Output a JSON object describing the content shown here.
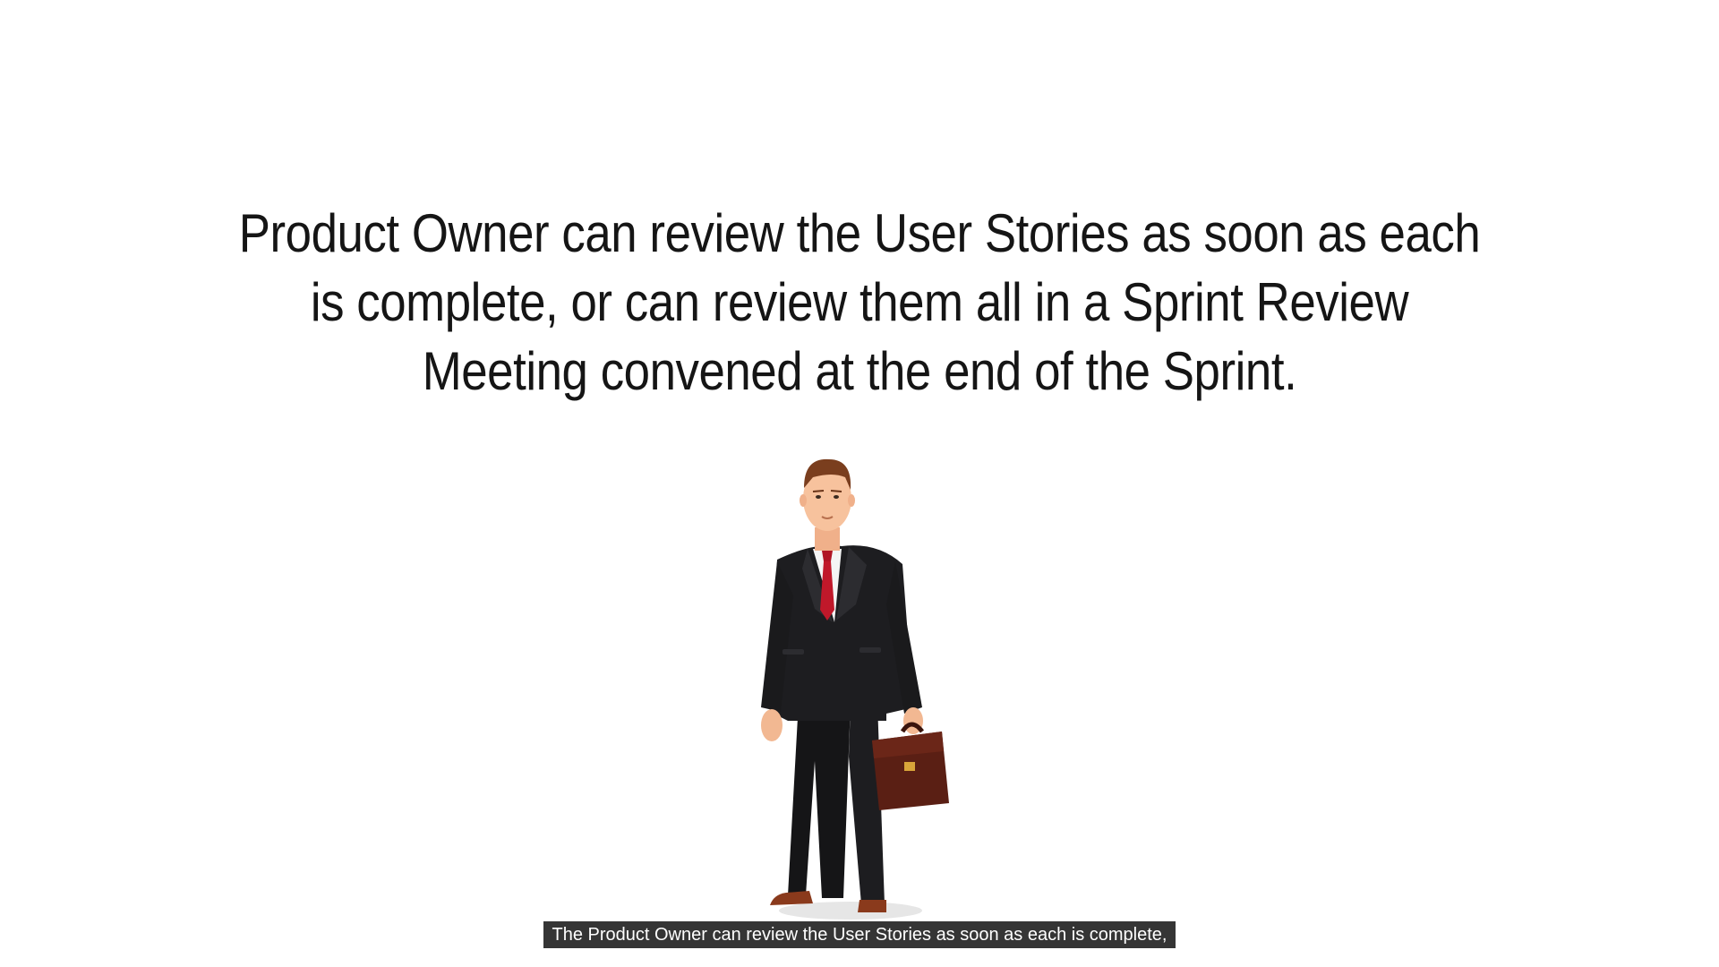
{
  "slide": {
    "headline": "Product Owner can review the User Stories as soon as each is complete, or can review them all in a Sprint Review Meeting convened at the end of the Sprint.",
    "figure_icon": "businessman-with-briefcase-illustration"
  },
  "caption": {
    "text": "The Product Owner can review the User Stories as soon as each is complete,"
  },
  "colors": {
    "background": "#ffffff",
    "headline_text": "#151515",
    "caption_background": "#141414",
    "caption_text": "#ffffff",
    "suit": "#1c1c1e",
    "tie": "#c0182a",
    "briefcase": "#5a1f14"
  }
}
